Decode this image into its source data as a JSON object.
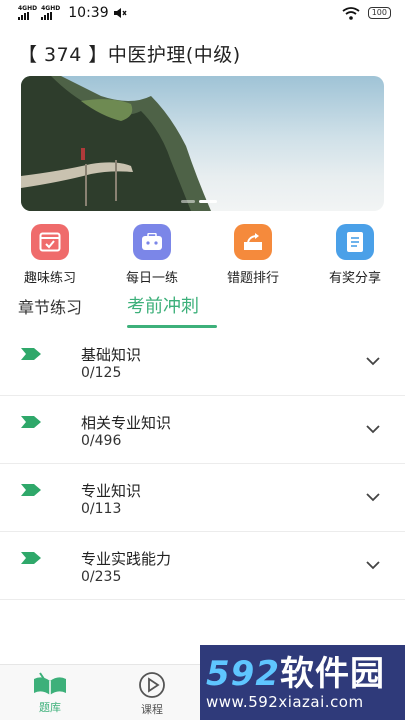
{
  "status_bar": {
    "net1": "4G",
    "net1_sup": "HD",
    "net2": "4G",
    "net2_sup": "HD",
    "time": "10:39",
    "battery": "100"
  },
  "page_title": "【 374 】中医护理(中级)",
  "features": [
    {
      "label": "趣味练习",
      "icon": "browser-check-icon",
      "color": "#ef6b6b"
    },
    {
      "label": "每日一练",
      "icon": "briefcase-icon",
      "color": "#7b86e8"
    },
    {
      "label": "错题排行",
      "icon": "share-box-icon",
      "color": "#f58a3c"
    },
    {
      "label": "有奖分享",
      "icon": "notebook-icon",
      "color": "#4aa0e8"
    }
  ],
  "tabs": [
    {
      "label": "章节练习"
    },
    {
      "label": "考前冲刺"
    }
  ],
  "chapters": [
    {
      "name": "基础知识",
      "count": "0/125"
    },
    {
      "name": "相关专业知识",
      "count": "0/496"
    },
    {
      "name": "专业知识",
      "count": "0/113"
    },
    {
      "name": "专业实践能力",
      "count": "0/235"
    }
  ],
  "bottom_nav": [
    {
      "label": "题库"
    },
    {
      "label": "课程"
    }
  ],
  "watermark": {
    "num": "592",
    "cn": "软件园",
    "url": "www.592xiazai.com"
  },
  "colors": {
    "accent": "#3db07a"
  }
}
